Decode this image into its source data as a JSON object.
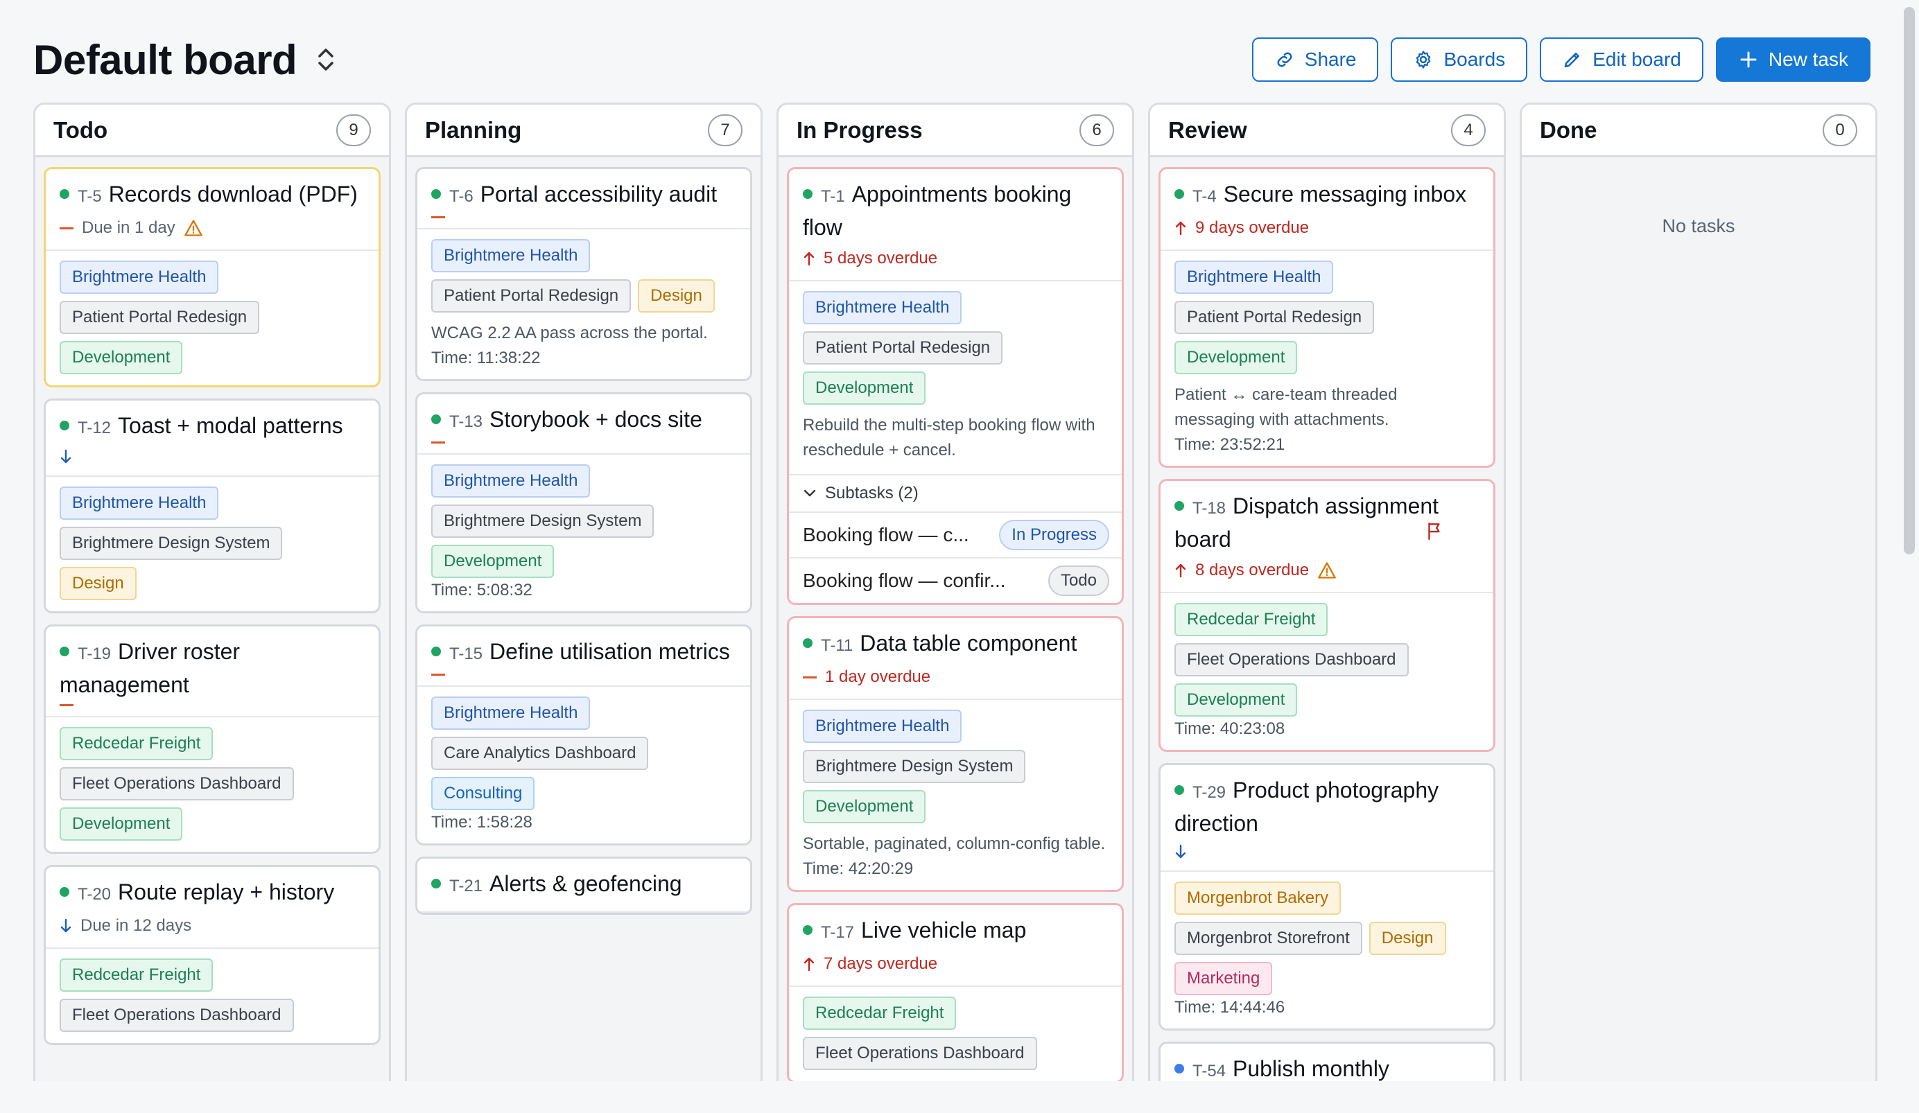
{
  "header": {
    "title": "Default board",
    "actions": {
      "share": "Share",
      "boards": "Boards",
      "edit": "Edit board",
      "new_task": "New task"
    }
  },
  "colors": {
    "accent": "#1577d6",
    "overdue": "#c0281f",
    "green_dot": "#1fa464"
  },
  "columns": [
    {
      "title": "Todo",
      "count": "9",
      "cards": [
        {
          "id": "T-5",
          "title": "Records download (PDF)",
          "meta": "Due in 1 day",
          "tags": [
            "Brightmere Health",
            "Patient Portal Redesign",
            "Development"
          ]
        },
        {
          "id": "T-12",
          "title": "Toast + modal patterns",
          "tags": [
            "Brightmere Health",
            "Brightmere Design System",
            "Design"
          ]
        },
        {
          "id": "T-19",
          "title": "Driver roster management",
          "tags": [
            "Redcedar Freight",
            "Fleet Operations Dashboard",
            "Development"
          ]
        },
        {
          "id": "T-20",
          "title": "Route replay + history",
          "meta": "Due in 12 days",
          "tags": [
            "Redcedar Freight",
            "Fleet Operations Dashboard"
          ]
        }
      ]
    },
    {
      "title": "Planning",
      "count": "7",
      "cards": [
        {
          "id": "T-6",
          "title": "Portal accessibility audit",
          "tags": [
            "Brightmere Health",
            "Patient Portal Redesign",
            "Design"
          ],
          "desc": "WCAG 2.2 AA pass across the portal.",
          "time": "Time: 11:38:22"
        },
        {
          "id": "T-13",
          "title": "Storybook + docs site",
          "tags": [
            "Brightmere Health",
            "Brightmere Design System",
            "Development"
          ],
          "time": "Time: 5:08:32"
        },
        {
          "id": "T-15",
          "title": "Define utilisation metrics",
          "tags": [
            "Brightmere Health",
            "Care Analytics Dashboard",
            "Consulting"
          ],
          "time": "Time: 1:58:28"
        },
        {
          "id": "T-21",
          "title": "Alerts & geofencing"
        }
      ]
    },
    {
      "title": "In Progress",
      "count": "6",
      "cards": [
        {
          "id": "T-1",
          "title": "Appointments booking flow",
          "meta": "5 days overdue",
          "tags": [
            "Brightmere Health",
            "Patient Portal Redesign",
            "Development"
          ],
          "desc": "Rebuild the multi-step booking flow with reschedule + cancel.",
          "subtasks_label": "Subtasks (2)",
          "subtasks": [
            {
              "label": "Booking flow — c...",
              "status": "In Progress"
            },
            {
              "label": "Booking flow — confir...",
              "status": "Todo"
            }
          ]
        },
        {
          "id": "T-11",
          "title": "Data table component",
          "meta": "1 day overdue",
          "tags": [
            "Brightmere Health",
            "Brightmere Design System",
            "Development"
          ],
          "desc": "Sortable, paginated, column-config table.",
          "time": "Time: 42:20:29"
        },
        {
          "id": "T-17",
          "title": "Live vehicle map",
          "meta": "7 days overdue",
          "tags": [
            "Redcedar Freight",
            "Fleet Operations Dashboard"
          ]
        }
      ]
    },
    {
      "title": "Review",
      "count": "4",
      "cards": [
        {
          "id": "T-4",
          "title": "Secure messaging inbox",
          "meta": "9 days overdue",
          "tags": [
            "Brightmere Health",
            "Patient Portal Redesign",
            "Development"
          ],
          "desc": "Patient ↔ care-team threaded messaging with attachments.",
          "time": "Time: 23:52:21"
        },
        {
          "id": "T-18",
          "title": "Dispatch assignment board",
          "meta": "8 days overdue",
          "tags": [
            "Redcedar Freight",
            "Fleet Operations Dashboard",
            "Development"
          ],
          "time": "Time: 40:23:08"
        },
        {
          "id": "T-29",
          "title": "Product photography direction",
          "tags": [
            "Morgenbrot Bakery",
            "Morgenbrot Storefront",
            "Design",
            "Marketing"
          ],
          "time": "Time: 14:44:46"
        },
        {
          "id": "T-54",
          "title": "Publish monthly"
        }
      ]
    },
    {
      "title": "Done",
      "count": "0",
      "empty": "No tasks"
    }
  ]
}
